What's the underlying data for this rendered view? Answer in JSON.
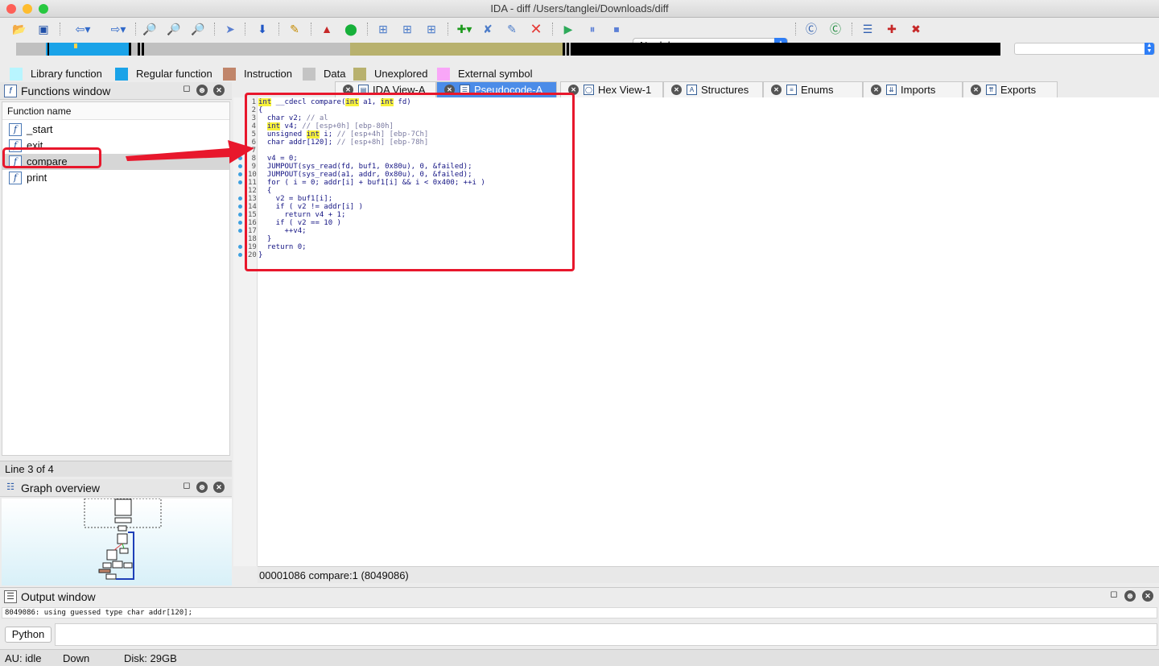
{
  "window": {
    "title": "IDA - diff /Users/tanglei/Downloads/diff"
  },
  "toolbar": {
    "debugger_select": "No debugger",
    "icons": [
      "open-icon",
      "save-icon",
      "back-icon",
      "forward-icon",
      "search-binary-icon",
      "search-text-icon",
      "search-immediate-icon",
      "jump-icon",
      "navigate-down-icon",
      "marker-icon",
      "warning-icon",
      "green-circle-icon",
      "add-segment-icon",
      "graph-icon",
      "add-struct-icon",
      "create-function-icon",
      "split-icon",
      "edit-icon",
      "delete-icon",
      "run-icon",
      "pause-icon",
      "stop-icon",
      "hex-rays-icon",
      "debug-icon",
      "report-icon",
      "add-breakpoint-icon",
      "remove-breakpoint-icon"
    ]
  },
  "legend": [
    {
      "label": "Library function",
      "color": "#b8f5ff"
    },
    {
      "label": "Regular function",
      "color": "#1aa3e8"
    },
    {
      "label": "Instruction",
      "color": "#c0856a"
    },
    {
      "label": "Data",
      "color": "#c4c4c4"
    },
    {
      "label": "Unexplored",
      "color": "#b8b16e"
    },
    {
      "label": "External symbol",
      "color": "#f9a6f8"
    }
  ],
  "functions_window": {
    "title": "Functions window",
    "column_header": "Function name",
    "items": [
      "_start",
      "exit",
      "compare",
      "print"
    ],
    "selected": "compare",
    "status": "Line 3 of 4"
  },
  "graph_overview": {
    "title": "Graph overview"
  },
  "tabs": [
    {
      "label": "IDA View-A",
      "icon": "ida-view-icon",
      "active": false
    },
    {
      "label": "Pseudocode-A",
      "icon": "pseudocode-icon",
      "active": true
    },
    {
      "label": "Hex View-1",
      "icon": "hex-view-icon",
      "active": false
    },
    {
      "label": "Structures",
      "icon": "structures-icon",
      "active": false
    },
    {
      "label": "Enums",
      "icon": "enums-icon",
      "active": false
    },
    {
      "label": "Imports",
      "icon": "imports-icon",
      "active": false
    },
    {
      "label": "Exports",
      "icon": "exports-icon",
      "active": false
    }
  ],
  "pseudocode": {
    "lines": [
      {
        "n": "1",
        "text": "int __cdecl compare(int a1, int fd)",
        "dot": false
      },
      {
        "n": "2",
        "text": "{",
        "dot": false
      },
      {
        "n": "3",
        "text": "  char v2; // al",
        "dot": false
      },
      {
        "n": "4",
        "text": "  int v4; // [esp+0h] [ebp-80h]",
        "dot": false
      },
      {
        "n": "5",
        "text": "  unsigned int i; // [esp+4h] [ebp-7Ch]",
        "dot": false
      },
      {
        "n": "6",
        "text": "  char addr[120]; // [esp+8h] [ebp-78h]",
        "dot": false
      },
      {
        "n": "7",
        "text": "",
        "dot": false
      },
      {
        "n": "8",
        "text": "  v4 = 0;",
        "dot": true
      },
      {
        "n": "9",
        "text": "  JUMPOUT(sys_read(fd, buf1, 0x80u), 0, &failed);",
        "dot": true
      },
      {
        "n": "10",
        "text": "  JUMPOUT(sys_read(a1, addr, 0x80u), 0, &failed);",
        "dot": true
      },
      {
        "n": "11",
        "text": "  for ( i = 0; addr[i] + buf1[i] && i < 0x400; ++i )",
        "dot": true
      },
      {
        "n": "12",
        "text": "  {",
        "dot": false
      },
      {
        "n": "13",
        "text": "    v2 = buf1[i];",
        "dot": true
      },
      {
        "n": "14",
        "text": "    if ( v2 != addr[i] )",
        "dot": true
      },
      {
        "n": "15",
        "text": "      return v4 + 1;",
        "dot": true
      },
      {
        "n": "16",
        "text": "    if ( v2 == 10 )",
        "dot": true
      },
      {
        "n": "17",
        "text": "      ++v4;",
        "dot": true
      },
      {
        "n": "18",
        "text": "  }",
        "dot": false
      },
      {
        "n": "19",
        "text": "  return 0;",
        "dot": true
      },
      {
        "n": "20",
        "text": "}",
        "dot": true
      }
    ],
    "status": "00001086  compare:1 (8049086)"
  },
  "output_window": {
    "title": "Output window",
    "text": "8049086: using guessed type char addr[120];",
    "language_button": "Python",
    "command_value": ""
  },
  "statusbar": {
    "au": "AU:  idle",
    "direction": "Down",
    "disk": "Disk: 29GB"
  },
  "colors": {
    "annotation": "#e8172c",
    "active_tab": "#4b8ce8"
  }
}
